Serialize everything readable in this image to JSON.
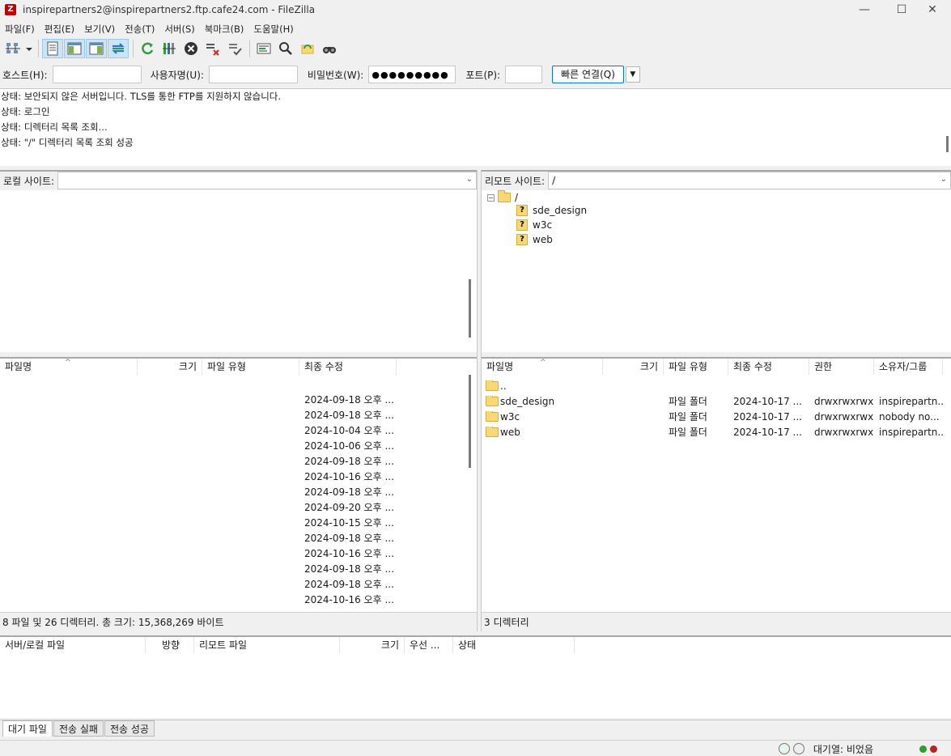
{
  "window": {
    "title": "inspirepartners2@inspirepartners2.ftp.cafe24.com - FileZilla",
    "app_icon": "Z",
    "controls": {
      "minimize": "—",
      "maximize": "☐",
      "close": "✕"
    }
  },
  "menu": [
    "파일(F)",
    "편집(E)",
    "보기(V)",
    "전송(T)",
    "서버(S)",
    "북마크(B)",
    "도움말(H)"
  ],
  "toolbar_icons": [
    "site-manager-icon",
    "dropdown-arrow-icon",
    "toggle-log-icon",
    "toggle-local-tree-icon",
    "toggle-remote-tree-icon",
    "toggle-queue-icon",
    "refresh-icon",
    "process-queue-icon",
    "cancel-icon",
    "disconnect-icon",
    "reconnect-icon",
    "directory-filter-icon",
    "compare-icon",
    "sync-browse-icon",
    "search-icon"
  ],
  "quickconnect": {
    "host_label": "호스트(H):",
    "host_value": "",
    "user_label": "사용자명(U):",
    "user_value": "",
    "pass_label": "비밀번호(W):",
    "pass_value": "●●●●●●●●●",
    "port_label": "포트(P):",
    "port_value": "",
    "connect_label": "빠른 연결(Q)",
    "dropdown": "▼"
  },
  "log": [
    "상태:  보안되지 않은 서버입니다. TLS를 통한 FTP를 지원하지 않습니다.",
    "상태:  로그인",
    "상태:  디렉터리 목록 조회...",
    "상태:  \"/\" 디렉터리 목록 조회 성공"
  ],
  "local": {
    "site_label": "로컬 사이트:",
    "path": "",
    "columns": [
      "파일명",
      "크기",
      "파일 유형",
      "최종 수정"
    ],
    "rows": [
      {
        "name": "",
        "size": "",
        "type": "",
        "modified": ""
      },
      {
        "name": "",
        "size": "",
        "type": "",
        "modified": "2024-09-18 오후 ..."
      },
      {
        "name": "",
        "size": "",
        "type": "",
        "modified": "2024-09-18 오후 ..."
      },
      {
        "name": "",
        "size": "",
        "type": "",
        "modified": "2024-10-04 오후 ..."
      },
      {
        "name": "",
        "size": "",
        "type": "",
        "modified": "2024-10-06 오후 ..."
      },
      {
        "name": "",
        "size": "",
        "type": "",
        "modified": "2024-09-18 오후 ..."
      },
      {
        "name": "",
        "size": "",
        "type": "",
        "modified": "2024-10-16 오후 ..."
      },
      {
        "name": "",
        "size": "",
        "type": "",
        "modified": "2024-09-18 오후 ..."
      },
      {
        "name": "",
        "size": "",
        "type": "",
        "modified": "2024-09-20 오후 ..."
      },
      {
        "name": "",
        "size": "",
        "type": "",
        "modified": "2024-10-15 오후 ..."
      },
      {
        "name": "",
        "size": "",
        "type": "",
        "modified": "2024-09-18 오후 ..."
      },
      {
        "name": "",
        "size": "",
        "type": "",
        "modified": "2024-10-16 오후 ..."
      },
      {
        "name": "",
        "size": "",
        "type": "",
        "modified": "2024-09-18 오후 ..."
      },
      {
        "name": "",
        "size": "",
        "type": "",
        "modified": "2024-09-18 오후 ..."
      },
      {
        "name": "",
        "size": "",
        "type": "",
        "modified": "2024-10-16 오후 ..."
      }
    ],
    "status": "8 파일 및 26 디렉터리. 총 크기: 15,368,269 바이트"
  },
  "remote": {
    "site_label": "리모트 사이트:",
    "path": "/",
    "tree": [
      {
        "name": "/",
        "level": 0,
        "kind": "folder-open"
      },
      {
        "name": "sde_design",
        "level": 1,
        "kind": "unknown"
      },
      {
        "name": "w3c",
        "level": 1,
        "kind": "unknown"
      },
      {
        "name": "web",
        "level": 1,
        "kind": "unknown"
      }
    ],
    "columns": [
      "파일명",
      "크기",
      "파일 유형",
      "최종 수정",
      "권한",
      "소유자/그룹"
    ],
    "rows": [
      {
        "name": "..",
        "size": "",
        "type": "",
        "modified": "",
        "perm": "",
        "owner": ""
      },
      {
        "name": "sde_design",
        "size": "",
        "type": "파일 폴더",
        "modified": "2024-10-17 ...",
        "perm": "drwxrwxrwx",
        "owner": "inspirepartn..."
      },
      {
        "name": "w3c",
        "size": "",
        "type": "파일 폴더",
        "modified": "2024-10-17 ...",
        "perm": "drwxrwxrwx",
        "owner": "nobody no..."
      },
      {
        "name": "web",
        "size": "",
        "type": "파일 폴더",
        "modified": "2024-10-17 ...",
        "perm": "drwxrwxrwx",
        "owner": "inspirepartn..."
      }
    ],
    "status": "3 디렉터리"
  },
  "queue": {
    "columns": [
      "서버/로컬 파일",
      "방향",
      "리모트 파일",
      "크기",
      "우선 ...",
      "상태"
    ],
    "tabs": [
      "대기 파일",
      "전송 실패",
      "전송 성공"
    ],
    "status": "대기열: 비었음"
  },
  "colors": {
    "accent": "#0078d4",
    "folder": "#f8d775",
    "led_green": "#2aa02a",
    "led_red": "#c02020"
  }
}
